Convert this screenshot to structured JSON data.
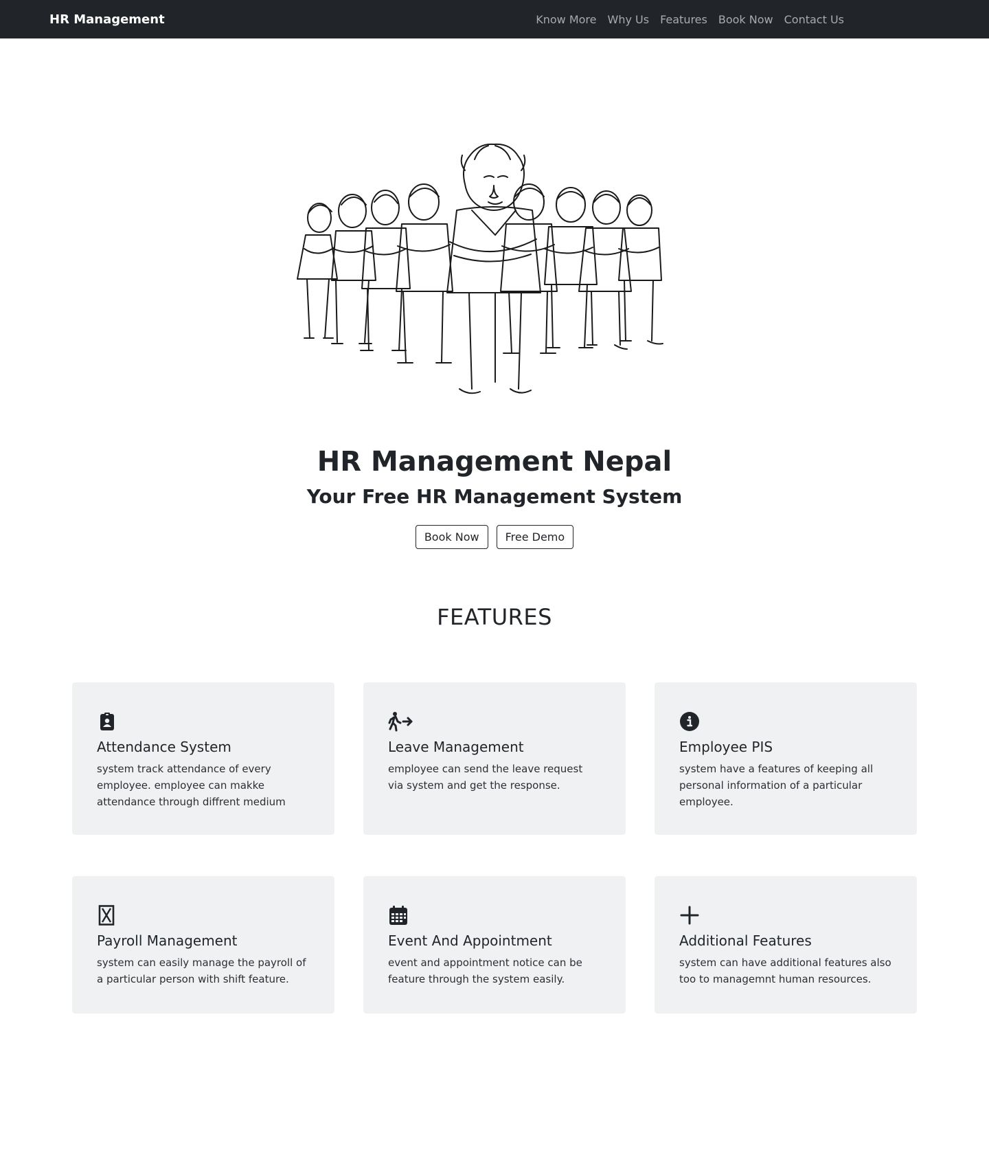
{
  "navbar": {
    "brand": "HR Management",
    "links": [
      "Know More",
      "Why Us",
      "Features",
      "Book Now",
      "Contact Us"
    ]
  },
  "hero": {
    "title": "HR Management Nepal",
    "subtitle": "Your Free HR Management System",
    "buttons": {
      "book_now": "Book Now",
      "free_demo": "Free Demo"
    }
  },
  "features": {
    "heading": "FEATURES",
    "cards": [
      {
        "icon": "clipboard-user-icon",
        "title": "Attendance System",
        "text": "system track attendance of every employee. employee can makke attendance through diffrent medium"
      },
      {
        "icon": "walking-person-arrow-icon",
        "title": "Leave Management",
        "text": "employee can send the leave request via system and get the response."
      },
      {
        "icon": "info-circle-icon",
        "title": "Employee PIS",
        "text": "system have a features of keeping all personal information of a particular employee."
      },
      {
        "icon": "hourglass-icon",
        "title": "Payroll Management",
        "text": "system can easily manage the payroll of a particular person with shift feature."
      },
      {
        "icon": "calendar-icon",
        "title": "Event And Appointment",
        "text": "event and appointment notice can be feature through the system easily."
      },
      {
        "icon": "plus-icon",
        "title": "Additional Features",
        "text": "system can have additional features also too to managemnt human resources."
      }
    ]
  },
  "colors": {
    "navbar_bg": "#212529",
    "card_bg": "#f0f1f3",
    "text": "#212529"
  }
}
